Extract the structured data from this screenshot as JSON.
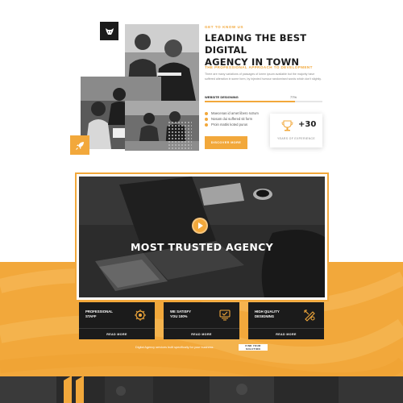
{
  "about": {
    "eyebrow": "GET TO KNOW US",
    "headline_line1": "LEADING THE BEST DIGITAL",
    "headline_line2": "AGENCY IN TOWN",
    "subheading": "THE PROFESSIONAL APPROACH TO DEVELOPMENT",
    "paragraph": "There are many variations of passages of lorem ipsum available but the majority have suffered alteration in some form, by injected humour randomised words which don't slightly.",
    "skill": {
      "label": "WEBSITE DESIGNING",
      "percent_text": "77%",
      "percent": 77
    },
    "bullets": [
      "Maecenas id amet libero rutrum",
      "Nosam dui suffered sit form",
      "Proin mattis koted purus"
    ],
    "discover_button": "DISCOVER MORE",
    "experience": {
      "number": "+30",
      "label": "YEARS OF EXPERIENCE"
    },
    "icons": {
      "logo": "bull-logo-icon",
      "rocket": "rocket-icon",
      "experience": "trophy-puzzle-icon"
    }
  },
  "hero": {
    "title": "MOST TRUSTED AGENCY",
    "play_icon": "play-icon"
  },
  "features": [
    {
      "title_line1": "PROFESSIONAL",
      "title_line2": "STAFF",
      "button": "READ MORE",
      "icon": "team-gear-icon"
    },
    {
      "title_line1": "WE SATISFY",
      "title_line2": "YOU 100%",
      "button": "READ MORE",
      "icon": "satisfaction-icon"
    },
    {
      "title_line1": "HIGH QUALITY",
      "title_line2": "DESIGNING",
      "button": "READ MORE",
      "icon": "design-tools-icon"
    }
  ],
  "cta": {
    "text": "Digital Agency services built specifically for your business.",
    "button": "FIND YOUR SOLUTION"
  },
  "colors": {
    "accent": "#f2a83b",
    "dark": "#1b1b1b",
    "text_muted": "#888888"
  }
}
